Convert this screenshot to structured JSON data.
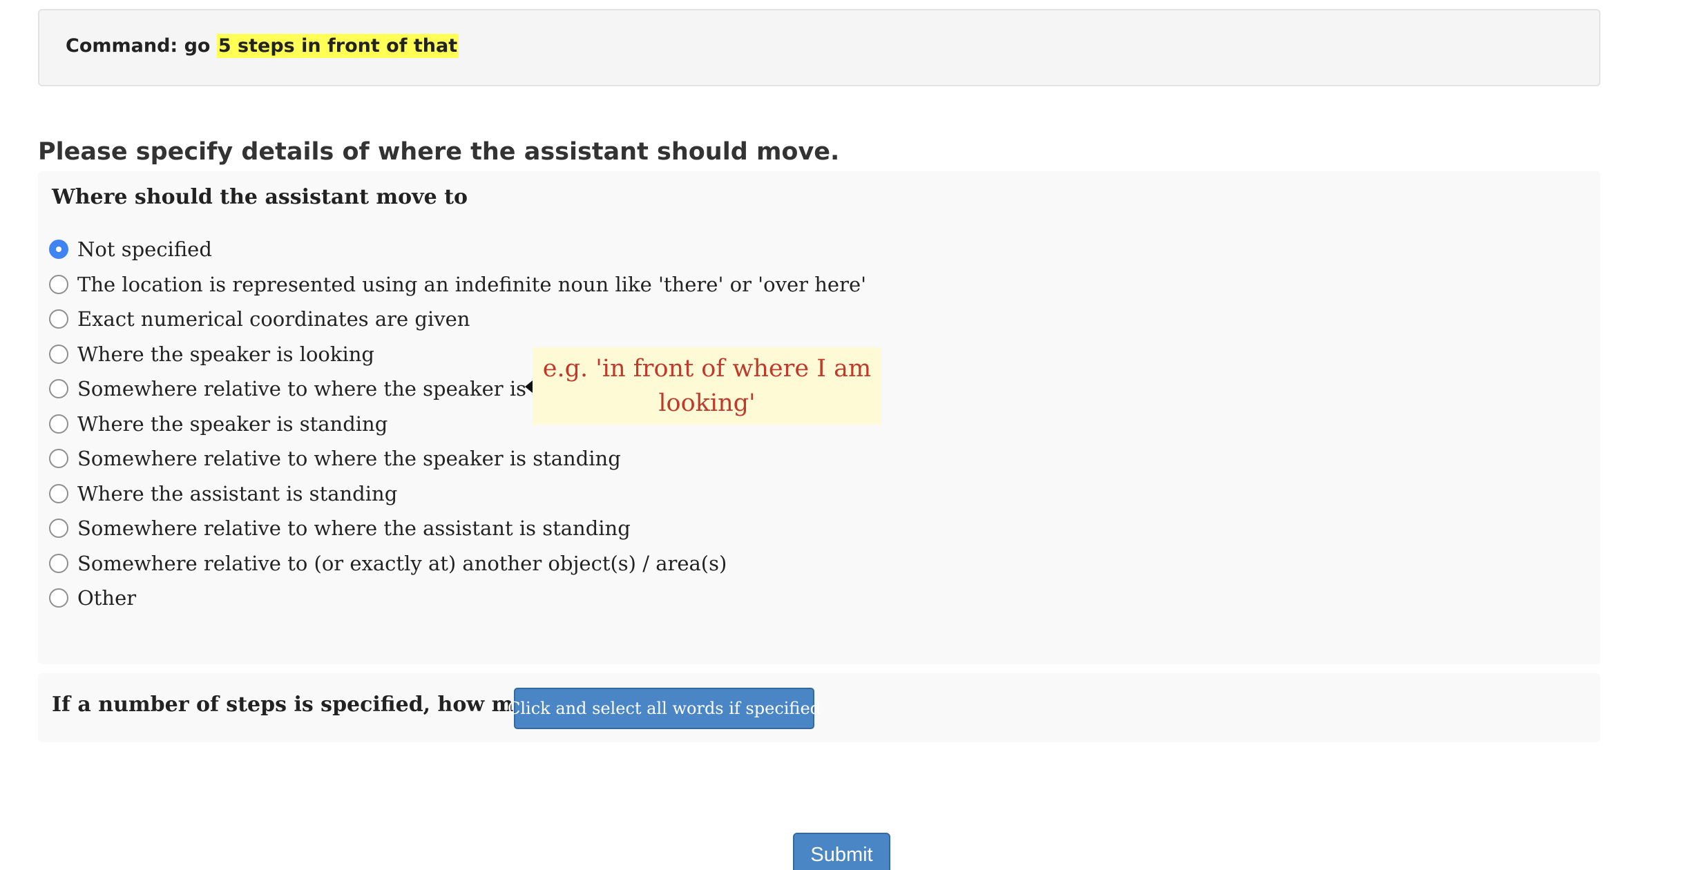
{
  "command": {
    "prefix": "Command: go ",
    "highlight": "5 steps in front of that",
    "highlight_color": "#ffff55"
  },
  "heading": "Please specify details of where the assistant should move.",
  "location_question": {
    "title": "Where should the assistant move to",
    "selected_index": 0,
    "options": [
      "Not specified",
      "The location is represented using an indefinite noun like 'there' or 'over here'",
      "Exact numerical coordinates are given",
      "Where the speaker is looking",
      "Somewhere relative to where the speaker is looking",
      "Where the speaker is standing",
      "Somewhere relative to where the speaker is standing",
      "Where the assistant is standing",
      "Somewhere relative to where the assistant is standing",
      "Somewhere relative to (or exactly at) another object(s) / area(s)",
      "Other"
    ]
  },
  "tooltip": {
    "text": "e.g. 'in front of where I am looking'",
    "text_color": "#c0392b",
    "background": "#fffad6"
  },
  "steps_question": {
    "title": "If a number of steps is specified, how many ?",
    "button_label": "Click and select all words if specified"
  },
  "submit_label": "Submit",
  "colors": {
    "accent": "#3f84f3",
    "button": "#4a86c6",
    "panel_background": "#f9f9f9"
  }
}
